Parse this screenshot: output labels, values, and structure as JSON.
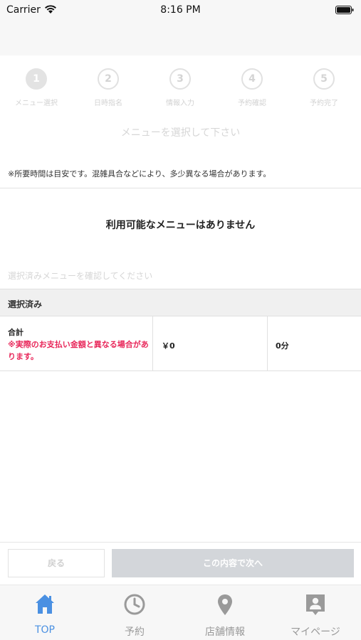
{
  "status_bar": {
    "carrier": "Carrier",
    "time": "8:16 PM"
  },
  "steps": [
    {
      "number": "1",
      "label": "メニュー選択",
      "active": true
    },
    {
      "number": "2",
      "label": "日時指名",
      "active": false
    },
    {
      "number": "3",
      "label": "情報入力",
      "active": false
    },
    {
      "number": "4",
      "label": "予約確認",
      "active": false
    },
    {
      "number": "5",
      "label": "予約完了",
      "active": false
    }
  ],
  "menu_section": {
    "heading": "メニューを選択して下さい",
    "notice": "※所要時間は目安です。混雑具合などにより、多少異なる場合があります。",
    "empty_message": "利用可能なメニューはありません"
  },
  "selected_section": {
    "hint": "選択済みメニューを確認してください",
    "header": "選択済み",
    "total_label": "合計",
    "total_warning": "※実際のお支払い金額と異なる場合があります。",
    "total_price": "￥0",
    "total_time": "0分"
  },
  "footer": {
    "back_label": "戻る",
    "next_label": "この内容で次へ"
  },
  "tabs": [
    {
      "label": "TOP",
      "icon": "home-icon",
      "active": true
    },
    {
      "label": "予約",
      "icon": "clock-icon",
      "active": false
    },
    {
      "label": "店舗情報",
      "icon": "map-pin-icon",
      "active": false
    },
    {
      "label": "マイページ",
      "icon": "profile-icon",
      "active": false
    }
  ],
  "colors": {
    "accent": "#4a90e2",
    "warning": "#e8275a",
    "disabled": "#d3d6da"
  }
}
